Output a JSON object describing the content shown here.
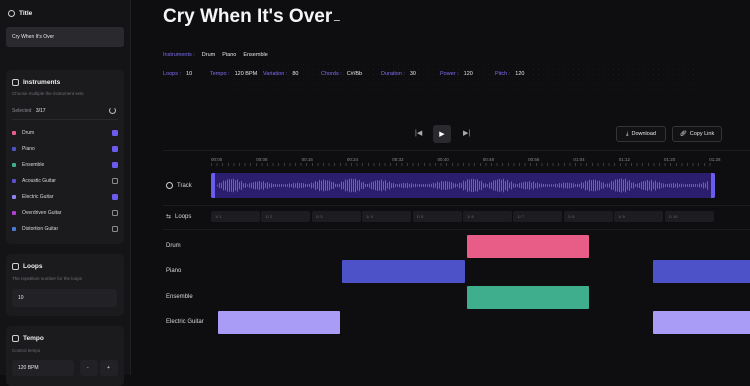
{
  "sidebar": {
    "title_panel": {
      "heading": "Title",
      "value": "Cry When It's Over"
    },
    "instruments_panel": {
      "heading": "Instruments",
      "subtitle": "Choose multiple the instrument sets",
      "selected_label": "Selected",
      "selected_count": "3/17",
      "items": [
        {
          "label": "Drum",
          "color": "#e85d87",
          "checked": true
        },
        {
          "label": "Piano",
          "color": "#4d52c9",
          "checked": true
        },
        {
          "label": "Ensemble",
          "color": "#3fae8d",
          "checked": true
        },
        {
          "label": "Acoustic Guitar",
          "color": "#5a4fcf",
          "checked": false
        },
        {
          "label": "Electric Guitar",
          "color": "#8e83f5",
          "checked": true
        },
        {
          "label": "Overdriven Guitar",
          "color": "#b03fd8",
          "checked": false
        },
        {
          "label": "Distortion Guitar",
          "color": "#4a7ad8",
          "checked": false
        }
      ]
    },
    "loops_panel": {
      "heading": "Loops",
      "subtitle": "The repetition number for the loops",
      "value": "10"
    },
    "tempo_panel": {
      "heading": "Tempo",
      "subtitle": "Control tempo",
      "value": "120 BPM",
      "minus": "-",
      "plus": "+"
    }
  },
  "main": {
    "title": "Cry When It's Over",
    "meta_row1": [
      {
        "key": "Instruments :",
        "values": [
          "Drum",
          "Piano",
          "Ensemble"
        ]
      }
    ],
    "meta_row2": [
      {
        "key": "Loops :",
        "value": "10"
      },
      {
        "key": "Tempo :",
        "value": "120 BPM"
      },
      {
        "key": "Variation :",
        "value": "80"
      },
      {
        "key": "Chords :",
        "value": "C#/Bb"
      },
      {
        "key": "Duration :",
        "value": "30"
      },
      {
        "key": "Power :",
        "value": "120"
      },
      {
        "key": "Pitch :",
        "value": "120"
      }
    ],
    "download_label": "Download",
    "copy_link_label": "Copy Link",
    "time_ticks": [
      "00:00",
      "00:08",
      "00:16",
      "00:24",
      "00:32",
      "00:40",
      "00:48",
      "00:56",
      "01:04",
      "01:12",
      "01:20",
      "01:28"
    ],
    "track_label": "Track",
    "loops_label": "Loops",
    "loop_cells": [
      "1/ 1",
      "1/ 2",
      "1/ 3",
      "1/ 4",
      "1/ 5",
      "1/ 6",
      "1/ 7",
      "1/ 8",
      "1/ 9",
      "1/ 10"
    ],
    "arrangement": [
      {
        "label": "Drum",
        "color": "#e85d87",
        "segments": [
          [
            5,
            6
          ]
        ]
      },
      {
        "label": "Piano",
        "color": "#4d52c9",
        "segments": [
          [
            3,
            4
          ],
          [
            8,
            9
          ]
        ]
      },
      {
        "label": "Ensemble",
        "color": "#3fae8d",
        "segments": [
          [
            5,
            6
          ]
        ]
      },
      {
        "label": "Electric Guitar",
        "color": "#a99cf7",
        "segments": [
          [
            1,
            2
          ],
          [
            8,
            9
          ]
        ]
      }
    ]
  }
}
